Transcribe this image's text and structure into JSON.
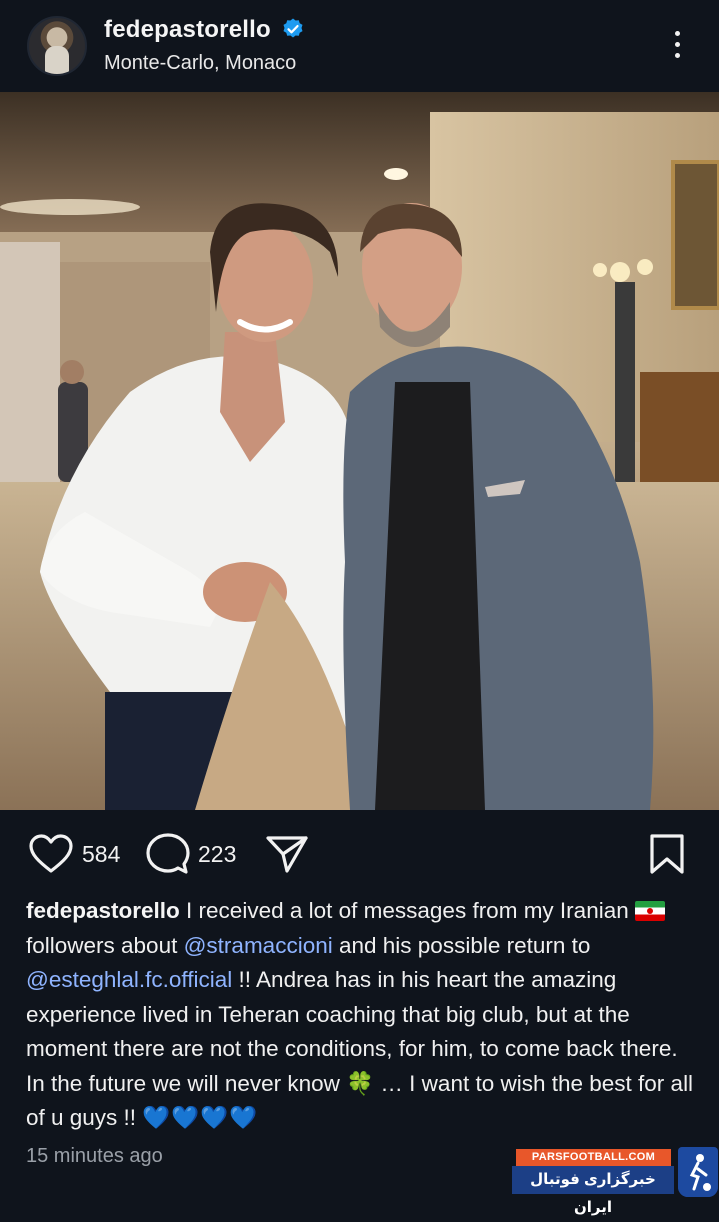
{
  "post": {
    "username": "fedepastorello",
    "location": "Monte-Carlo, Monaco",
    "likes": "584",
    "comments": "223",
    "timestamp": "15 minutes ago"
  },
  "caption": {
    "username": "fedepastorello",
    "text_1": " I received a lot of messages from my Iranian ",
    "text_2": "followers about ",
    "mention_1": "@stramaccioni",
    "text_3": " and his possible return to ",
    "mention_2": "@esteghlal.fc.official",
    "text_4": " !! Andrea has in his heart the amazing experience lived in Teheran coaching that big club, but at the moment there are not the conditions, for him, to come back there. In the future we will never know ",
    "clover": "🍀",
    "text_5": " … I want to wish the best for all of u guys !! ",
    "hearts": "💙💙💙💙"
  },
  "watermark": {
    "site": "PARSFOOTBALL.COM",
    "name_fa": "خبرگزاری فوتبال ایران"
  },
  "icons": {
    "verified": "verified-badge-icon",
    "more": "more-options-icon",
    "like": "heart-icon",
    "comment": "comment-bubble-icon",
    "share": "paper-plane-icon",
    "save": "bookmark-icon"
  },
  "colors": {
    "background": "#0f141c",
    "mention": "#8fb4ff",
    "verified": "#1d9bf0",
    "timestamp": "#9aa0a8",
    "watermark_orange": "#e8572a",
    "watermark_blue": "#1c3f86"
  }
}
